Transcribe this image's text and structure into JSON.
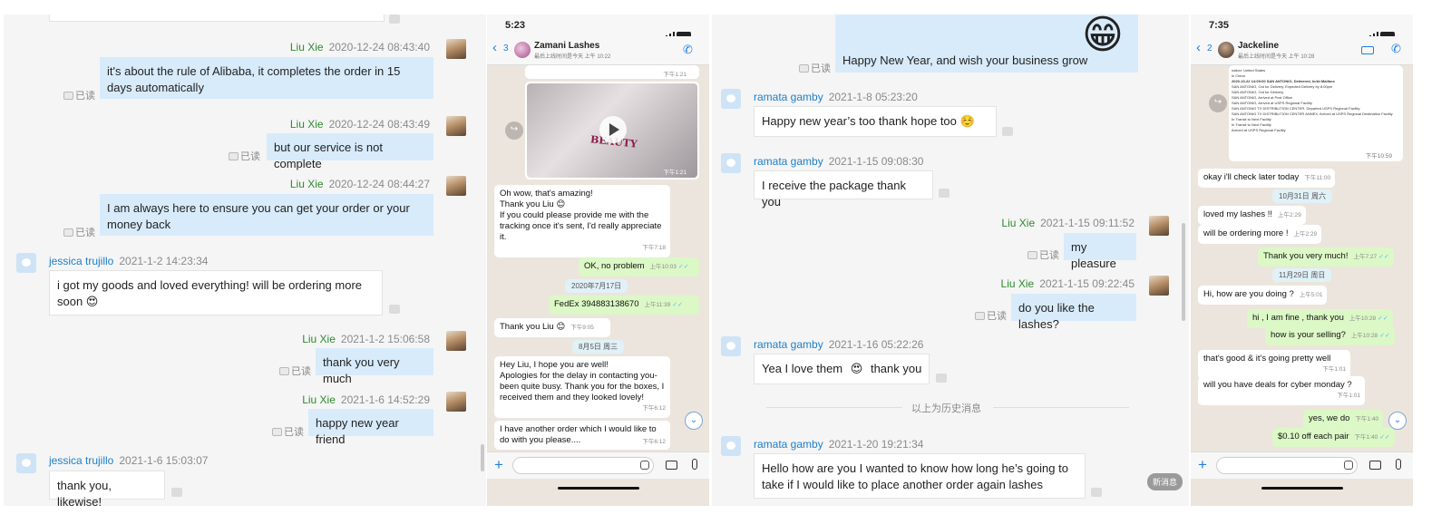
{
  "colors": {
    "outgoing_bubble": "#d8ebfb",
    "outgoing_name": "#2e8b2e",
    "incoming_name": "#1e7fc9",
    "wa_outgoing": "#dcf8c6",
    "wa_background": "#ece5dd"
  },
  "panel1": {
    "read_label": "已读",
    "messages": [
      {
        "name": "Liu Xie",
        "time": "2020-12-24 08:43:40",
        "text": "it's about the rule of Alibaba, it completes the order in 15 days automatically"
      },
      {
        "name": "Liu Xie",
        "time": "2020-12-24 08:43:49",
        "text": "but our service is not complete"
      },
      {
        "name": "Liu Xie",
        "time": "2020-12-24 08:44:27",
        "text": "I am always here to ensure you can get your order or your money back"
      },
      {
        "name": "jessica trujillo",
        "time": "2021-1-2 14:23:34",
        "text": "i got my goods and loved everything! will be ordering more soon 😍"
      },
      {
        "name": "Liu Xie",
        "time": "2021-1-2 15:06:58",
        "text": "thank you very much"
      },
      {
        "name": "Liu Xie",
        "time": "2021-1-6 14:52:29",
        "text": "happy new year friend"
      },
      {
        "name": "jessica trujillo",
        "time": "2021-1-6 15:03:07",
        "text": "thank you, likewise!"
      }
    ]
  },
  "panel2": {
    "status_time": "5:23",
    "back_count": "3",
    "contact_name": "Zamani Lashes",
    "contact_sub": "最后上线时间是今天 上午 10:22",
    "video_caption": "BEAUTY",
    "messages": [
      {
        "text": "Oh wow, that's amazing!\nThank you Liu 😊\nIf you could please provide me with the tracking once it's sent, I'd really appreciate it.",
        "time": "下午7:18"
      },
      {
        "text": "OK, no problem",
        "time": "上午10:03"
      },
      {
        "date": "2020年7月17日"
      },
      {
        "text": "FedEx 394883138670",
        "time": "上午11:39"
      },
      {
        "text": "Thank you Liu 😊",
        "time": "下午9:05"
      },
      {
        "date": "8月5日 周三"
      },
      {
        "text": "Hey Liu, I hope you are well!\nApologies for the delay in contacting you- been quite busy. Thank you for the boxes, I received them and they looked lovely!",
        "time": "下午6:12"
      },
      {
        "text": "I have another order which I would like to do with you please....",
        "time": "下午6:12"
      }
    ],
    "top_time": "下午1:21",
    "media_time": "下午1:21"
  },
  "panel3": {
    "read_label": "已读",
    "history_label": "以上为历史消息",
    "new_msg_label": "新消息",
    "messages": [
      {
        "text": "Happy New Year, and wish your business grow"
      },
      {
        "name": "ramata gamby",
        "time": "2021-1-8 05:23:20",
        "text": "Happy new year’s too thank hope too ☺️"
      },
      {
        "name": "ramata gamby",
        "time": "2021-1-15 09:08:30",
        "text": "I receive the package thank you"
      },
      {
        "name": "Liu Xie",
        "time": "2021-1-15 09:11:52",
        "text": "my pleasure"
      },
      {
        "name": "Liu Xie",
        "time": "2021-1-15 09:22:45",
        "text": "do you like the lashes?"
      },
      {
        "name": "ramata gamby",
        "time": "2021-1-16 05:22:26",
        "text_a": "Yea I love them",
        "emoji": "😍",
        "text_b": "thank you"
      },
      {
        "name": "ramata gamby",
        "time": "2021-1-20 19:21:34",
        "text": "Hello how are you I wanted to know how long he’s going to take if I would like to place another order again lashes"
      }
    ],
    "grin_emoji": "😁"
  },
  "panel4": {
    "status_time": "7:35",
    "back_count": "2",
    "contact_name": "Jackeline",
    "contact_sub": "最后上线时间是今天 上午 10:28",
    "doc_lines": [
      "nation: United States",
      "in China",
      "2020-10-22 14:09:00 SAN ANTONIO, Delivered, In/At Mailbox",
      "SAN ANTONIO, Out for Delivery, Expected Delivery by 8:00pm",
      "SAN ANTONIO, Out for Delivery",
      "SAN ANTONIO, Arrived at Post Office",
      "SAN ANTONIO, Arrived at USPS Regional Facility",
      "SAN ANTONIO TX DISTRIBUTION CENTER, Departed USPS Regional Facility",
      "SAN ANTONIO TX DISTRIBUTION CENTER ANNEX, Arrived at USPS Regional Destination Facility",
      "In Transit to Next Facility",
      "In Transit to Next Facility",
      "Arrived at USPS Regional Facility"
    ],
    "doc_time": "下午10:59",
    "messages": [
      {
        "text": "okay i'll check later today",
        "time": "下午11:00"
      },
      {
        "date": "10月31日 周六"
      },
      {
        "text": "loved my lashes !!",
        "time": "上午2:29"
      },
      {
        "text": "will be ordering more !",
        "time": "上午2:29"
      },
      {
        "text": "Thank you very much!",
        "time": "上午7:27"
      },
      {
        "date": "11月29日 周日"
      },
      {
        "text": "Hi, how are you doing ?",
        "time": "上午5:01"
      },
      {
        "text": "hi , I am fine , thank you",
        "time": "上午10:28"
      },
      {
        "text": "how is your selling?",
        "time": "上午10:28"
      },
      {
        "text": "that's good & it's going pretty well",
        "time": "下午1:01"
      },
      {
        "text": "will you have deals for cyber monday ?",
        "time": "下午1:01"
      },
      {
        "text": "yes, we do",
        "time": "下午1:40"
      },
      {
        "text": "$0.10 off each pair",
        "time": "下午1:40"
      }
    ]
  }
}
